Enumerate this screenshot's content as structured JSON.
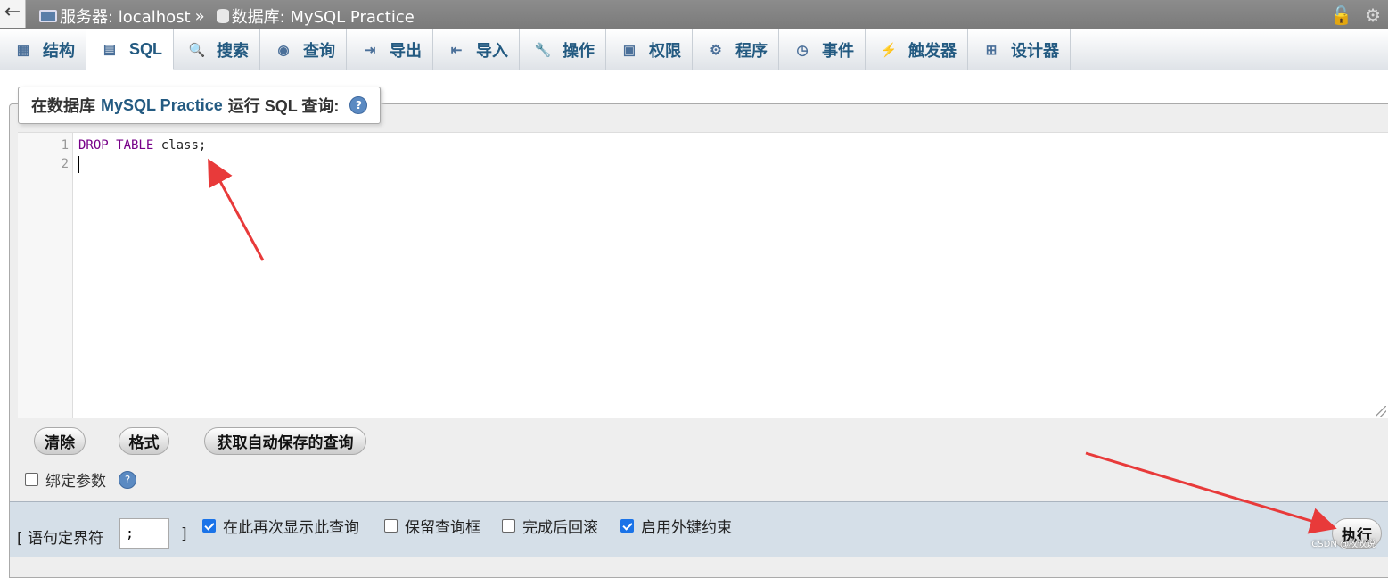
{
  "topbar": {
    "back": "←",
    "server_label": "服务器: localhost",
    "separator": "»",
    "db_label": "数据库: MySQL Practice"
  },
  "tabs": [
    {
      "label": "结构",
      "icon": "structure-icon"
    },
    {
      "label": "SQL",
      "icon": "sql-icon",
      "active": true
    },
    {
      "label": "搜索",
      "icon": "search-icon"
    },
    {
      "label": "查询",
      "icon": "query-icon"
    },
    {
      "label": "导出",
      "icon": "export-icon"
    },
    {
      "label": "导入",
      "icon": "import-icon"
    },
    {
      "label": "操作",
      "icon": "wrench-icon"
    },
    {
      "label": "权限",
      "icon": "privileges-icon"
    },
    {
      "label": "程序",
      "icon": "routines-icon"
    },
    {
      "label": "事件",
      "icon": "clock-icon"
    },
    {
      "label": "触发器",
      "icon": "triggers-icon"
    },
    {
      "label": "设计器",
      "icon": "designer-icon"
    }
  ],
  "panel": {
    "legend_prefix": "在数据库",
    "legend_db": "MySQL Practice",
    "legend_suffix": "运行 SQL 查询:",
    "help": "?"
  },
  "editor": {
    "line_numbers": [
      "1",
      "2"
    ],
    "keyword": "DROP TABLE",
    "rest": " class;"
  },
  "buttons": {
    "clear": "清除",
    "format": "格式",
    "restore": "获取自动保存的查询",
    "run": "执行"
  },
  "bind_params": {
    "label": "绑定参数",
    "checked": false
  },
  "options": {
    "delimiter_label": "[ 语句定界符",
    "delimiter_value": ";",
    "delimiter_close": "]",
    "show_again": {
      "label": "在此再次显示此查询",
      "checked": true
    },
    "keep_box": {
      "label": "保留查询框",
      "checked": false
    },
    "rollback": {
      "label": "完成后回滚",
      "checked": false
    },
    "foreign_keys": {
      "label": "启用外键约束",
      "checked": true
    }
  },
  "colors": {
    "accent": "#235a81",
    "arrow": "#e83a3a",
    "keyword": "#770088",
    "checkbox": "#1a73e8"
  },
  "watermark": "CSDN @枚攸说"
}
